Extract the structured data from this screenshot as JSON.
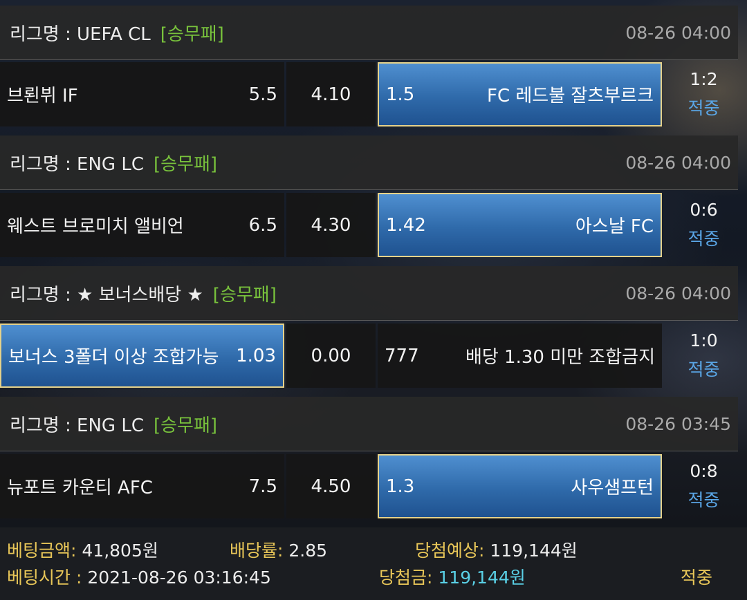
{
  "matches": [
    {
      "league_prefix": "리그명 : UEFA CL",
      "bet_type": "[승무패]",
      "datetime": "08-26 04:00",
      "home_team": "브뢴뷔 IF",
      "home_odds": "5.5",
      "draw_odds": "4.10",
      "away_odds": "1.5",
      "away_team": "FC 레드불 잘츠부르크",
      "score": "1:2",
      "status": "적중",
      "selected": "away"
    },
    {
      "league_prefix": "리그명 : ENG LC",
      "bet_type": "[승무패]",
      "datetime": "08-26 04:00",
      "home_team": "웨스트 브로미치 앨비언",
      "home_odds": "6.5",
      "draw_odds": "4.30",
      "away_odds": "1.42",
      "away_team": "아스날 FC",
      "score": "0:6",
      "status": "적중",
      "selected": "away"
    },
    {
      "league_prefix": "리그명 : ★ 보너스배당 ★",
      "bet_type": "[승무패]",
      "datetime": "08-26 04:00",
      "home_team": "보너스 3폴더 이상 조합가능",
      "home_odds": "1.03",
      "draw_odds": "0.00",
      "away_odds": "777",
      "away_team": "배당 1.30 미만 조합금지",
      "score": "1:0",
      "status": "적중",
      "selected": "home"
    },
    {
      "league_prefix": "리그명 : ENG LC",
      "bet_type": "[승무패]",
      "datetime": "08-26 03:45",
      "home_team": "뉴포트 카운티 AFC",
      "home_odds": "7.5",
      "draw_odds": "4.50",
      "away_odds": "1.3",
      "away_team": "사우샘프턴",
      "score": "0:8",
      "status": "적중",
      "selected": "away"
    }
  ],
  "summary": {
    "bet_amount_label": "베팅금액:",
    "bet_amount": "41,805원",
    "odds_label": "배당률:",
    "odds": "2.85",
    "expected_label": "당첨예상:",
    "expected": "119,144원",
    "bet_time_label": "베팅시간 :",
    "bet_time": "2021-08-26 03:16:45",
    "win_label": "당첨금:",
    "win_amount": "119,144원",
    "result": "적중"
  },
  "colors": {
    "selected_fill": "#2f6aaa",
    "selected_border": "#e6d28a",
    "bet_type": "#78c23c",
    "hit_status": "#5aa6e6",
    "summary_label": "#e8c658",
    "win_amount": "#5ad0e6"
  }
}
